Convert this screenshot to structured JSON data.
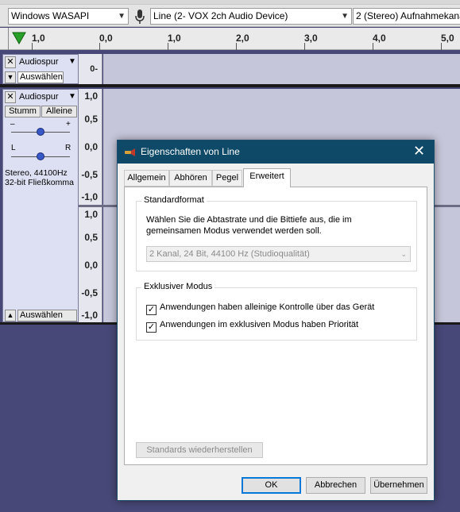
{
  "toolbar": {
    "host": "Windows WASAPI",
    "input_device": "Line (2- VOX 2ch Audio Device)",
    "channels": "2 (Stereo) Aufnahmekanä",
    "mic_icon": "microphone-icon"
  },
  "ruler": {
    "labels": [
      "1,0",
      "0,0",
      "1,0",
      "2,0",
      "3,0",
      "4,0",
      "5,0"
    ]
  },
  "track1": {
    "name": "Audiospur",
    "select": "Auswählen",
    "scale_value": "0-"
  },
  "track2": {
    "name": "Audiospur",
    "mute": "Stumm",
    "solo": "Alleine",
    "gain_minus": "–",
    "gain_plus": "+",
    "pan_left": "L",
    "pan_right": "R",
    "info_line1": "Stereo, 44100Hz",
    "info_line2": "32-bit Fließkomma",
    "select": "Auswählen",
    "scale_top": [
      "1,0",
      "0,5",
      "0,0",
      "-0,5",
      "-1,0"
    ],
    "scale_bottom": [
      "1,0",
      "0,5",
      "0,0",
      "-0,5",
      "-1,0"
    ]
  },
  "dialog": {
    "title": "Eigenschaften von Line",
    "tabs": [
      "Allgemein",
      "Abhören",
      "Pegel",
      "Erweitert"
    ],
    "active_tab": "Erweitert",
    "standard_format": {
      "title": "Standardformat",
      "description": "Wählen Sie die Abtastrate und die Bittiefe aus, die im gemeinsamen Modus verwendet werden soll.",
      "selected": "2 Kanal, 24 Bit, 44100 Hz (Studioqualität)"
    },
    "exclusive_mode": {
      "title": "Exklusiver Modus",
      "options": [
        {
          "label": "Anwendungen haben alleinige Kontrolle über das Gerät",
          "checked": true
        },
        {
          "label": "Anwendungen im exklusiven Modus haben Priorität",
          "checked": true
        }
      ]
    },
    "restore_defaults": "Standards wiederherstellen",
    "buttons": {
      "ok": "OK",
      "cancel": "Abbrechen",
      "apply": "Übernehmen"
    }
  },
  "colors": {
    "background": "#484878",
    "titlebar": "#0e4a68",
    "play_green": "#28a028"
  }
}
